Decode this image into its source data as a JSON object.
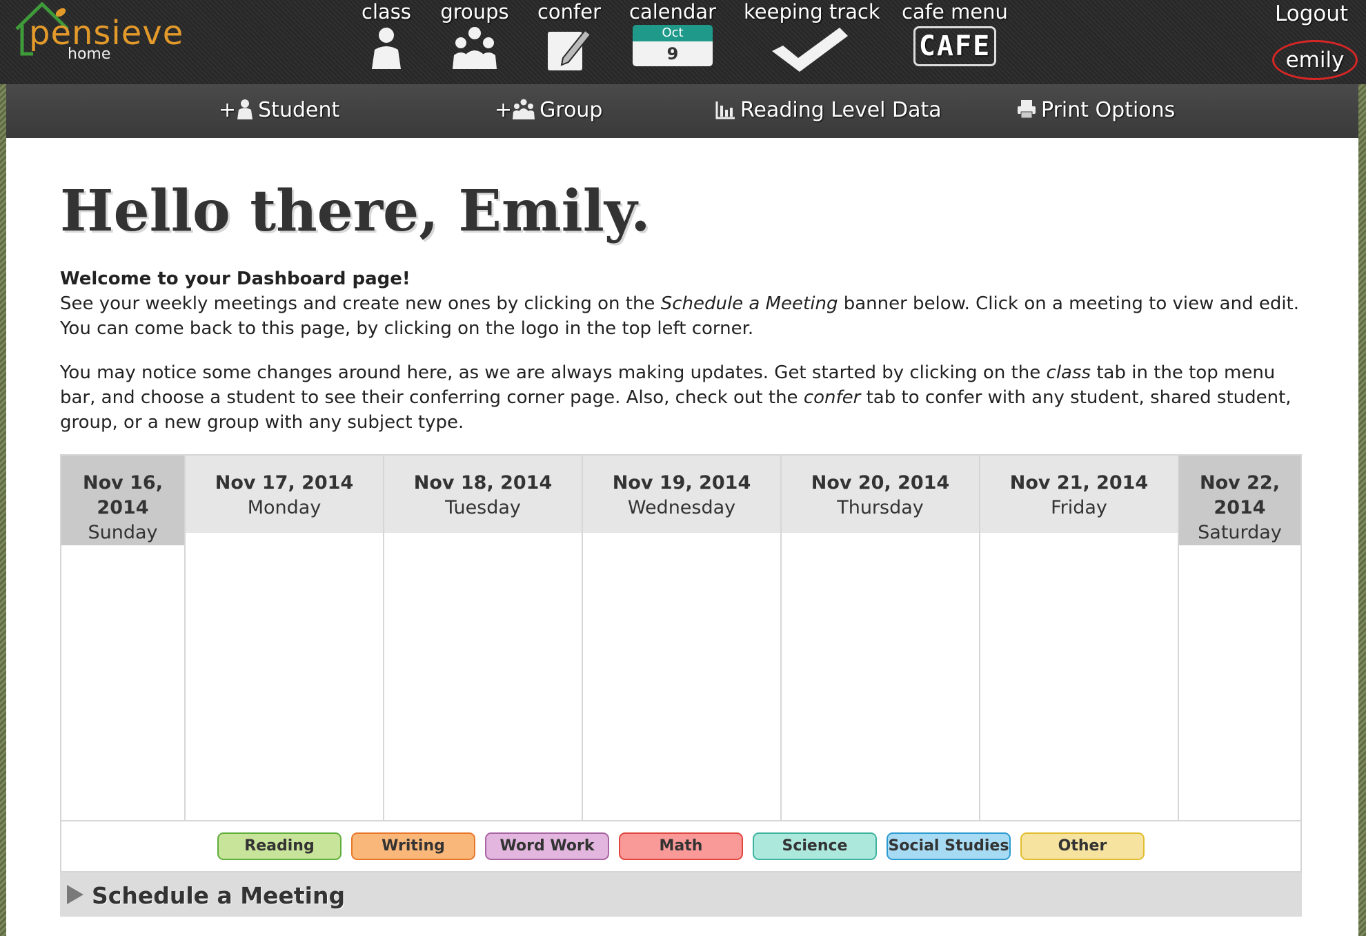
{
  "app": {
    "logo_text": "pensieve",
    "logo_sub": "home"
  },
  "topnav": {
    "items": [
      {
        "label": "class",
        "icon": "person-icon"
      },
      {
        "label": "groups",
        "icon": "group-icon"
      },
      {
        "label": "confer",
        "icon": "notepad-pencil-icon"
      },
      {
        "label": "calendar",
        "icon": "calendar-icon",
        "cal_month": "Oct",
        "cal_day": "9"
      },
      {
        "label": "keeping track",
        "icon": "checkmark-icon"
      },
      {
        "label": "cafe menu",
        "icon": "cafe-icon",
        "cafe_text": "CAFE"
      }
    ],
    "logout_label": "Logout",
    "user_name": "emily"
  },
  "subnav": {
    "items": [
      {
        "label": "Student",
        "prefix": "+",
        "icon": "add-student-icon"
      },
      {
        "label": "Group",
        "prefix": "+",
        "icon": "add-group-icon"
      },
      {
        "label": "Reading Level Data",
        "icon": "bar-chart-icon"
      },
      {
        "label": "Print Options",
        "icon": "printer-icon"
      }
    ]
  },
  "main": {
    "greeting": "Hello there, Emily.",
    "welcome_title": "Welcome to your Dashboard page!",
    "p1_a": "See your weekly meetings and create new ones by clicking on the ",
    "p1_em": "Schedule a Meeting",
    "p1_b": " banner below. Click on a meeting to view and edit. You can come back to this page, by clicking on the logo in the top left corner.",
    "p2_a": "You may notice some changes around here, as we are always making updates. Get started by clicking on the ",
    "p2_em1": "class",
    "p2_b": " tab in the top menu bar, and choose a student to see their conferring corner page. Also, check out the ",
    "p2_em2": "confer",
    "p2_c": " tab to confer with any student, shared student, group, or a new group with any subject type."
  },
  "calendar": {
    "days": [
      {
        "date": "Nov 16, 2014",
        "weekday": "Sunday",
        "weekend": true
      },
      {
        "date": "Nov 17, 2014",
        "weekday": "Monday",
        "weekend": false
      },
      {
        "date": "Nov 18, 2014",
        "weekday": "Tuesday",
        "weekend": false
      },
      {
        "date": "Nov 19, 2014",
        "weekday": "Wednesday",
        "weekend": false
      },
      {
        "date": "Nov 20, 2014",
        "weekday": "Thursday",
        "weekend": false
      },
      {
        "date": "Nov 21, 2014",
        "weekday": "Friday",
        "weekend": false
      },
      {
        "date": "Nov 22, 2014",
        "weekday": "Saturday",
        "weekend": true
      }
    ]
  },
  "subjects": [
    {
      "label": "Reading",
      "bg": "#c8e39a",
      "border": "#5fae3a"
    },
    {
      "label": "Writing",
      "bg": "#f9b87a",
      "border": "#e8772a"
    },
    {
      "label": "Word Work",
      "bg": "#e2b6de",
      "border": "#a964a3"
    },
    {
      "label": "Math",
      "bg": "#fa9a98",
      "border": "#e0463f"
    },
    {
      "label": "Science",
      "bg": "#ade8dd",
      "border": "#3fb39f"
    },
    {
      "label": "Social Studies",
      "bg": "#a6dbf3",
      "border": "#2d9bd1"
    },
    {
      "label": "Other",
      "bg": "#f6e3a0",
      "border": "#e2bd2f"
    }
  ],
  "schedule": {
    "label": "Schedule a Meeting"
  },
  "colors": {
    "accent_teal": "#1f9a8a",
    "logo_orange": "#e39a2a",
    "logo_green": "#3f9a3a",
    "highlight_red": "#d62626"
  }
}
